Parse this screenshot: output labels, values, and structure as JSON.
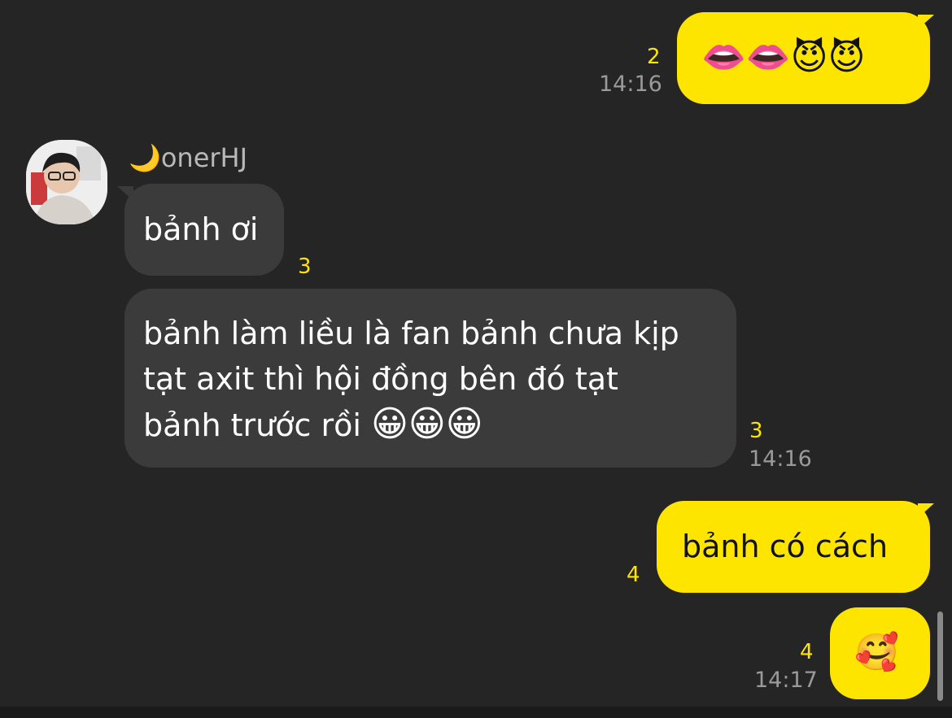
{
  "conversation": {
    "messages": [
      {
        "sender": "me",
        "text": "👄👄😈😈",
        "unread_count": "2",
        "time": "14:16"
      },
      {
        "sender": "other",
        "sender_name": "🌙onerHJ",
        "text": "bảnh ơi",
        "unread_count": "3"
      },
      {
        "sender": "other",
        "line1": "bảnh làm liều là fan bảnh chưa kịp",
        "line2": "tạt axit thì hội đồng bên đó tạt",
        "line3_text": "bảnh trước rồi ",
        "line3_emoji": "😀😀😀",
        "unread_count": "3",
        "time": "14:16"
      },
      {
        "sender": "me",
        "text": "bảnh có cách",
        "unread_count": "4"
      },
      {
        "sender": "me",
        "text": "🥰",
        "unread_count": "4",
        "time": "14:17"
      }
    ]
  },
  "icons": {
    "avatar": "profile-photo",
    "sender_prefix": "crescent-moon"
  },
  "colors": {
    "background": "#252525",
    "my_bubble": "#fee500",
    "their_bubble": "#3b3b3b",
    "unread": "#fee500",
    "time": "#9a9a9a"
  }
}
